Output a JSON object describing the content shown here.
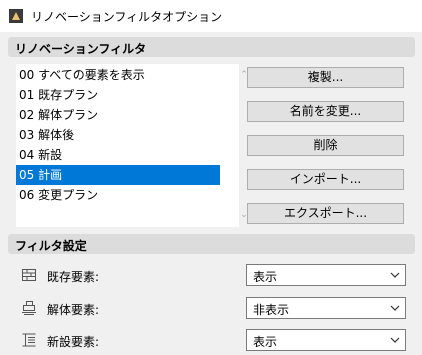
{
  "window": {
    "title": "リノベーションフィルタオプション",
    "icon": "archicad-app-icon"
  },
  "filters_section": {
    "header": "リノベーションフィルタ",
    "items": [
      {
        "label": "00 すべての要素を表示",
        "selected": false
      },
      {
        "label": "01 既存プラン",
        "selected": false
      },
      {
        "label": "02 解体プラン",
        "selected": false
      },
      {
        "label": "03 解体後",
        "selected": false
      },
      {
        "label": "04 新設",
        "selected": false
      },
      {
        "label": "05 計画",
        "selected": true
      },
      {
        "label": "06 変更プラン",
        "selected": false
      }
    ],
    "scroll_up_icon": "scroll-up-arrow",
    "scroll_down_icon": "scroll-down-arrow"
  },
  "buttons": {
    "duplicate": "複製...",
    "rename": "名前を変更...",
    "delete": "削除",
    "import": "インポート...",
    "export": "エクスポート..."
  },
  "settings_section": {
    "header": "フィルタ設定",
    "rows": [
      {
        "label": "既存要素:",
        "value": "表示",
        "icon": "existing-elements-icon"
      },
      {
        "label": "解体要素:",
        "value": "非表示",
        "icon": "demolished-elements-icon"
      },
      {
        "label": "新設要素:",
        "value": "表示",
        "icon": "new-elements-icon"
      }
    ]
  },
  "colors": {
    "selection": "#0078d7",
    "section_header_bg": "#dcdcdc",
    "dialog_bg": "#f0f0f0"
  }
}
